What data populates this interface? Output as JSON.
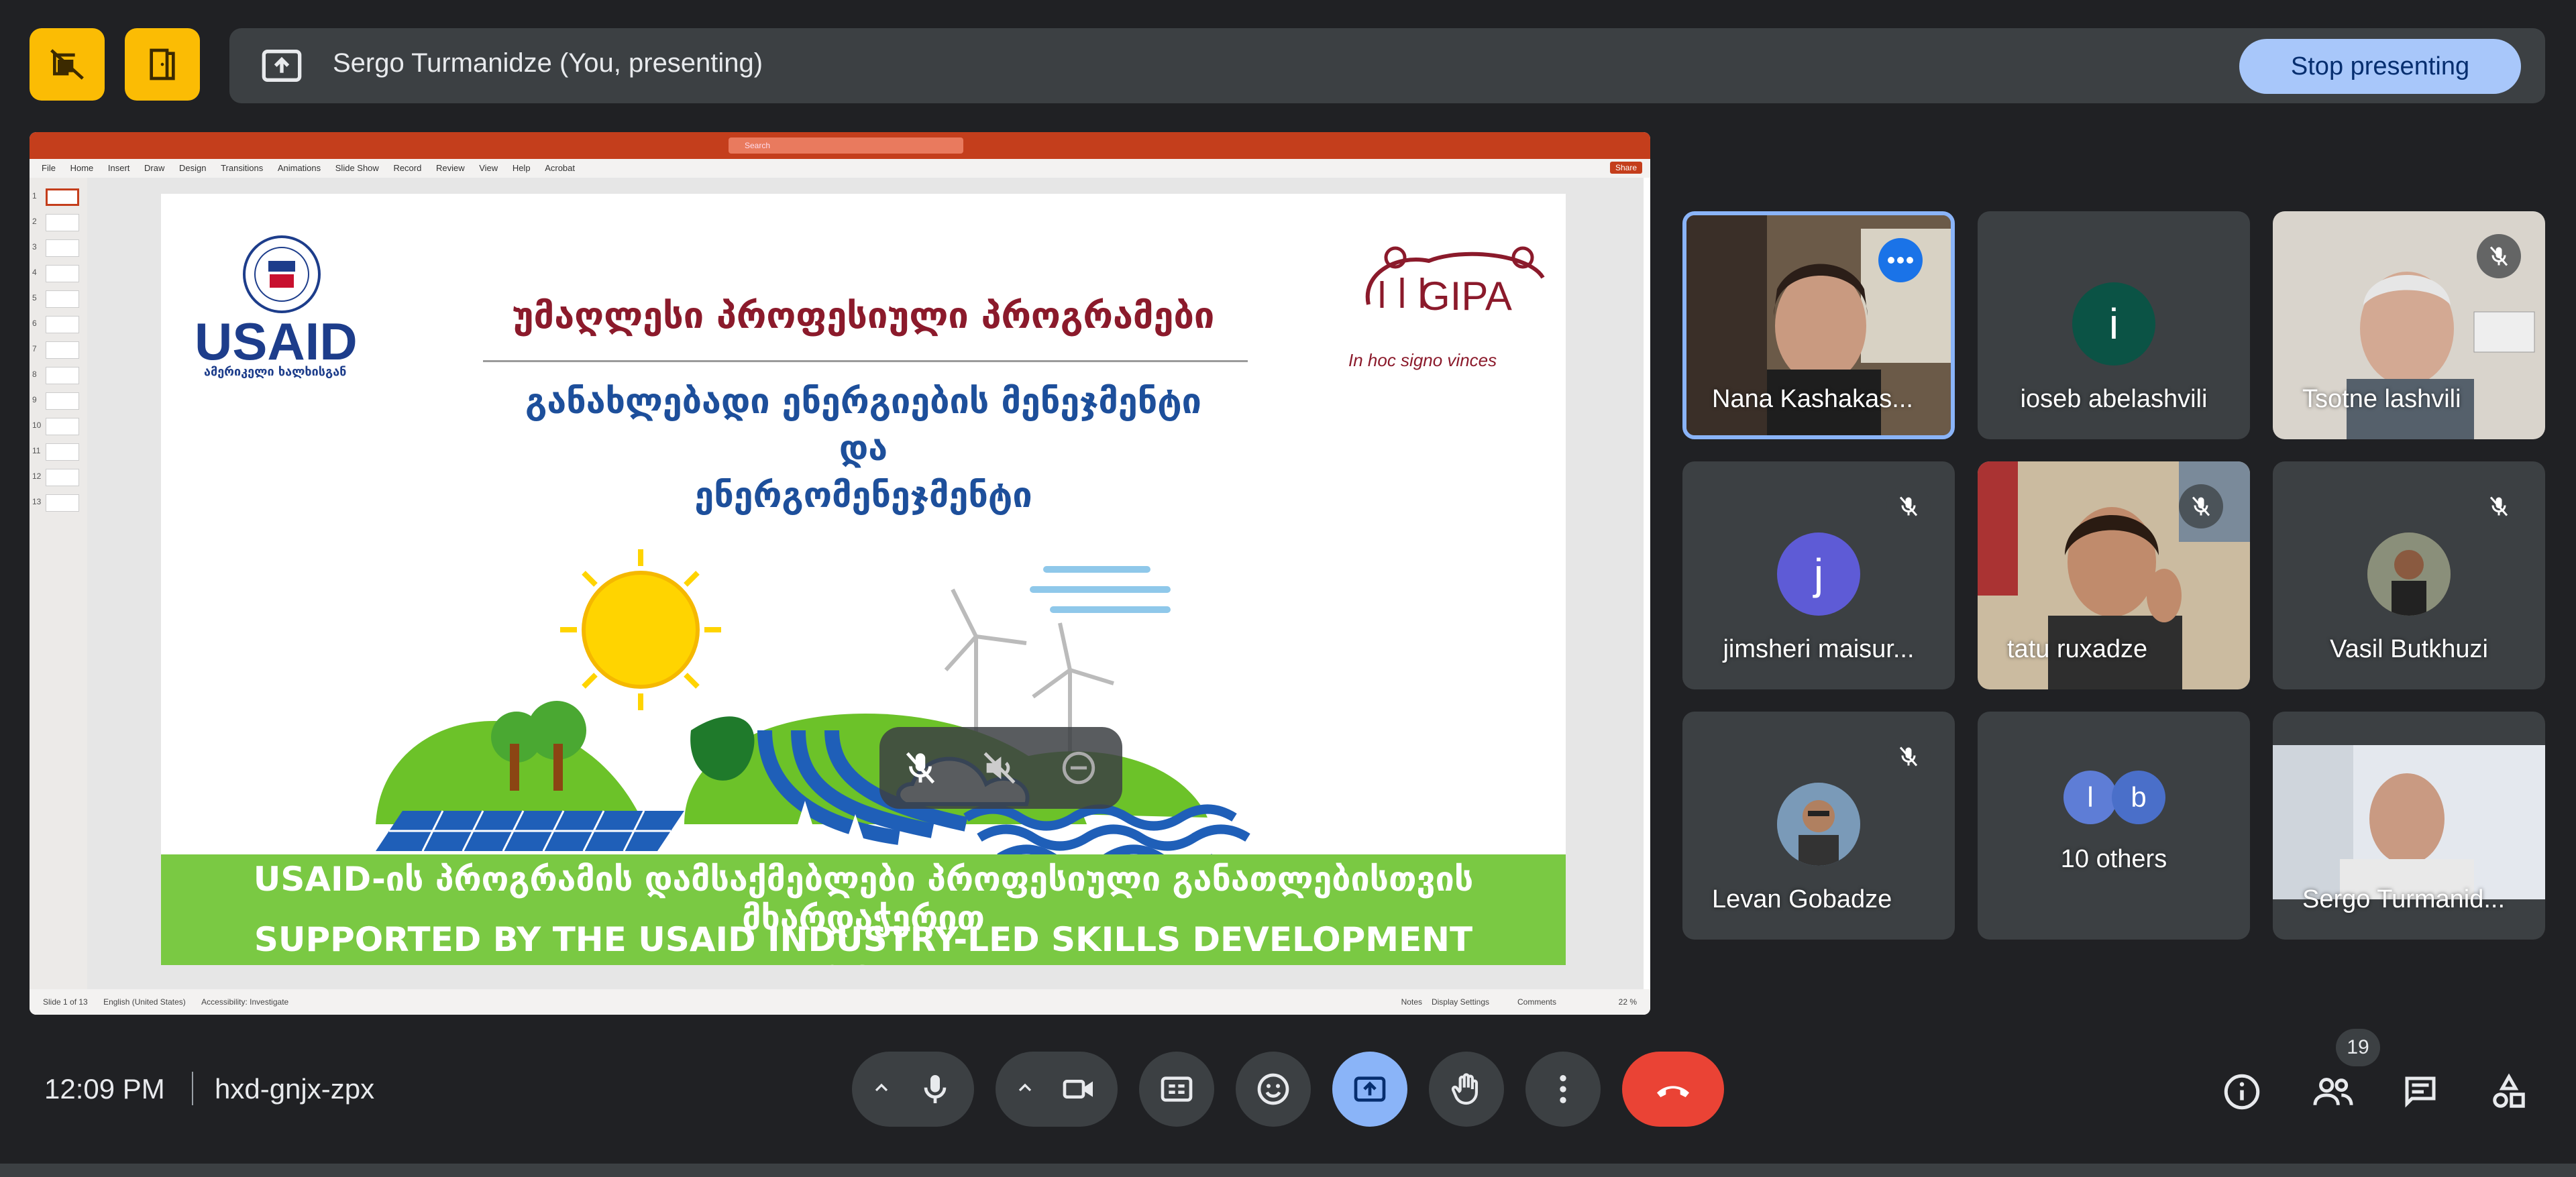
{
  "top": {
    "presenting_text": "Sergo Turmanidze (You, presenting)",
    "stop_presenting_label": "Stop presenting"
  },
  "slide": {
    "usaid_logo_text": "USAID",
    "usaid_sub": "ამერიკელი ხალხისგან",
    "gipa_logo": "GIPA",
    "gipa_motto": "In hoc signo vinces",
    "title_line1": "უმაღლესი პროფესიული პროგრამები",
    "title_line2": "განახლებადი ენერგიების მენეჯმენტი",
    "title_line3": "და",
    "title_line4": "ენერგომენეჯმენტი",
    "band_line1": "USAID-ის პროგრამის დამსაქმებლები პროფესიული განათლებისთვის მხარდაჭერით",
    "band_line2": "SUPPORTED BY THE USAID INDUSTRY-LED SKILLS DEVELOPMENT PROGRAM"
  },
  "ppt": {
    "menu": [
      "File",
      "Home",
      "Insert",
      "Draw",
      "Design",
      "Transitions",
      "Animations",
      "Slide Show",
      "Record",
      "Review",
      "View",
      "Help",
      "Acrobat"
    ],
    "search_placeholder": "Search",
    "share_label": "Share",
    "slide_count_text": "Slide 1 of 13",
    "language": "English (United States)",
    "accessibility": "Accessibility: Investigate",
    "notes": "Notes",
    "display_settings": "Display Settings",
    "comments": "Comments",
    "zoom": "22 %",
    "thumb_numbers": [
      "1",
      "2",
      "3",
      "4",
      "5",
      "6",
      "7",
      "8",
      "9",
      "10",
      "11",
      "12",
      "13"
    ]
  },
  "participants": [
    {
      "name": "Nana Kashakas...",
      "type": "video",
      "speaking": true
    },
    {
      "name": "ioseb abelashvili",
      "type": "avatar",
      "initial": "i",
      "color": "#0b5345"
    },
    {
      "name": "Tsotne lashvili",
      "type": "video",
      "muted": true
    },
    {
      "name": "jimsheri maisur...",
      "type": "avatar",
      "initial": "j",
      "color": "#5e5bd6",
      "muted": true
    },
    {
      "name": "tatu ruxadze",
      "type": "video",
      "muted": true
    },
    {
      "name": "Vasil Butkhuzi",
      "type": "photo",
      "muted": true
    },
    {
      "name": "Levan Gobadze",
      "type": "photo",
      "muted": true
    },
    {
      "name": "10 others",
      "type": "others",
      "initials": [
        "l",
        "b"
      ]
    },
    {
      "name": "Sergo Turmanid...",
      "type": "video"
    }
  ],
  "bottom": {
    "time": "12:09 PM",
    "meeting_code": "hxd-gnjx-zpx",
    "people_count": "19"
  }
}
